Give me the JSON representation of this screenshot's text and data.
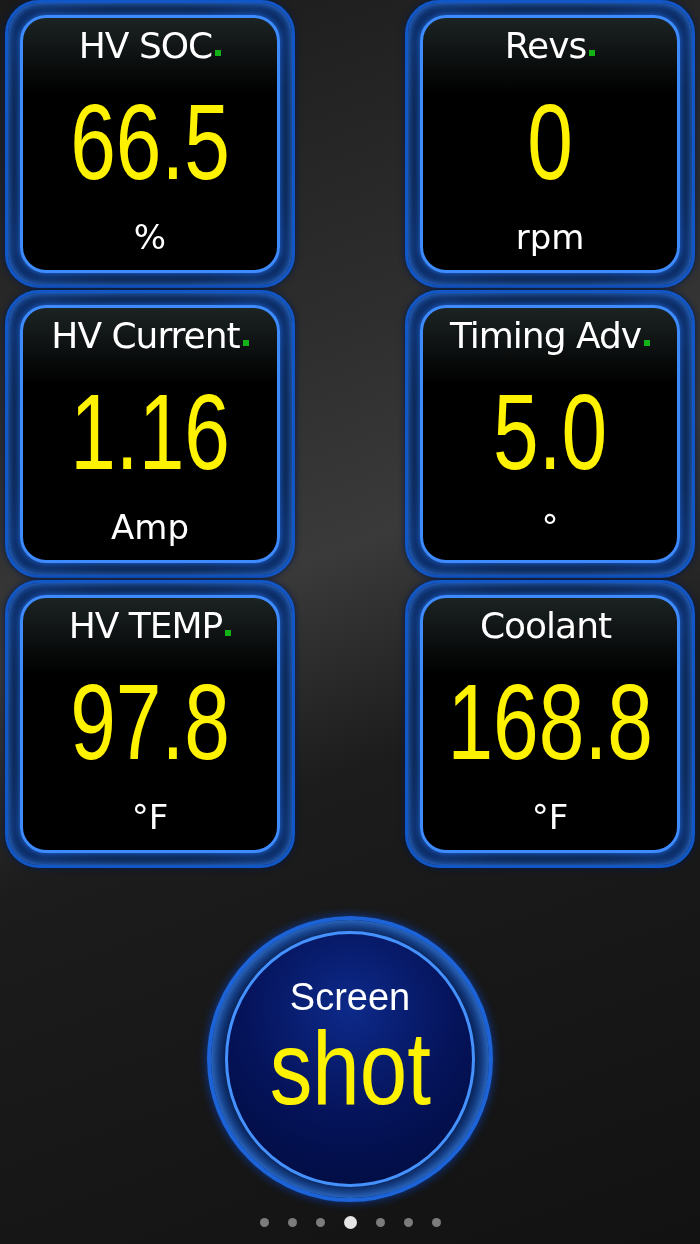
{
  "gauges": [
    {
      "title": "HV SOC",
      "value": "66.5",
      "unit": "%",
      "indicator": true
    },
    {
      "title": "Revs",
      "value": "0",
      "unit": "rpm",
      "indicator": true
    },
    {
      "title": "HV Current",
      "value": "1.16",
      "unit": "Amp",
      "indicator": true
    },
    {
      "title": "Timing Adv",
      "value": "5.0",
      "unit": "°",
      "indicator": true
    },
    {
      "title": "HV TEMP",
      "value": "97.8",
      "unit": "°F",
      "indicator": true
    },
    {
      "title": "Coolant",
      "value": "168.8",
      "unit": "°F",
      "indicator": false
    }
  ],
  "screenshot_button": {
    "line_1": "Screen",
    "line_2": "shot"
  },
  "pages": [
    {
      "selected": false
    },
    {
      "selected": false
    },
    {
      "selected": false
    },
    {
      "selected": true
    },
    {
      "selected": false
    },
    {
      "selected": false
    },
    {
      "selected": false
    }
  ]
}
